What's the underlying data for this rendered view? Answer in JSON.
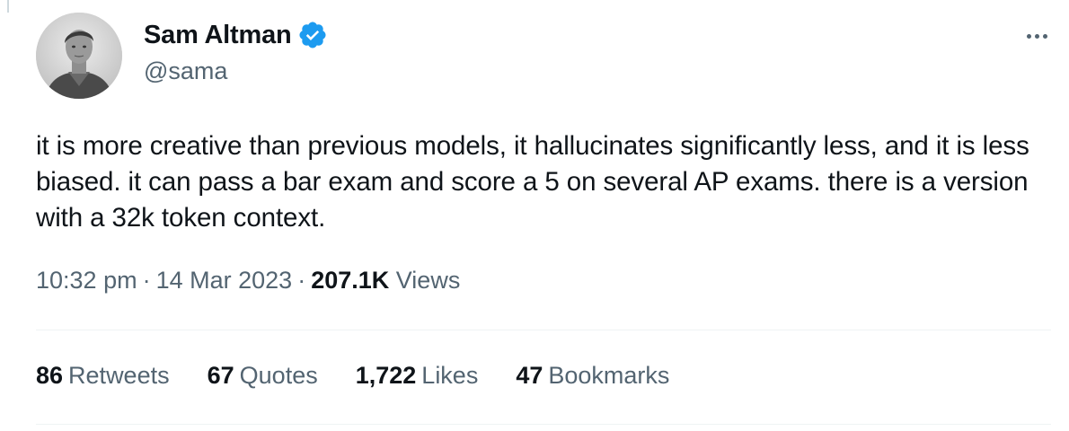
{
  "author": {
    "name": "Sam Altman",
    "handle": "@sama",
    "verified": true,
    "avatar_icon": "profile-photo",
    "verified_icon": "verified-badge-icon"
  },
  "tweet": {
    "text": "it is more creative than previous models, it hallucinates significantly less, and it is less biased. it can pass a bar exam and score a 5 on several AP exams. there is a version with a 32k token context.",
    "time": "10:32 pm",
    "date": "14 Mar 2023",
    "separator": "·",
    "views_count": "207.1K",
    "views_label": "Views"
  },
  "stats": [
    {
      "count": "86",
      "label": "Retweets"
    },
    {
      "count": "67",
      "label": "Quotes"
    },
    {
      "count": "1,722",
      "label": "Likes"
    },
    {
      "count": "47",
      "label": "Bookmarks"
    }
  ],
  "colors": {
    "text_primary": "#0f1419",
    "text_secondary": "#536471",
    "verified_blue": "#1d9bf0",
    "divider": "#eff3f4"
  },
  "icons": {
    "more": "more-options-icon"
  }
}
